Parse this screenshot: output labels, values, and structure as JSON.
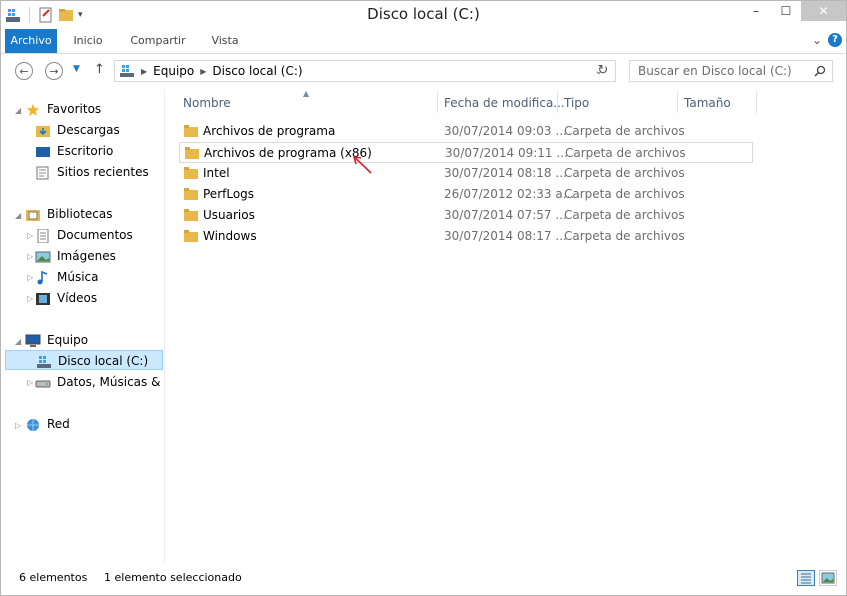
{
  "window": {
    "title": "Disco local (C:)",
    "minimize": "–",
    "maximize": "☐",
    "close": "✕"
  },
  "ribbon": {
    "tabs": [
      "Archivo",
      "Inicio",
      "Compartir",
      "Vista"
    ],
    "help": "?",
    "expand": "⌄"
  },
  "address": {
    "crumbs": [
      "Equipo",
      "Disco local (C:)"
    ],
    "search_placeholder": "Buscar en Disco local (C:)"
  },
  "navpane": {
    "favorites": "Favoritos",
    "fav_items": [
      "Descargas",
      "Escritorio",
      "Sitios recientes"
    ],
    "libraries": "Bibliotecas",
    "lib_items": [
      "Documentos",
      "Imágenes",
      "Música",
      "Vídeos"
    ],
    "computer": "Equipo",
    "comp_items": [
      "Disco local (C:)",
      "Datos, Músicas & Vi"
    ],
    "network": "Red"
  },
  "columns": {
    "name": "Nombre",
    "date": "Fecha de modifica...",
    "type": "Tipo",
    "size": "Tamaño"
  },
  "files": [
    {
      "name": "Archivos de programa",
      "date": "30/07/2014 09:03 ...",
      "type": "Carpeta de archivos"
    },
    {
      "name": "Archivos de programa (x86)",
      "date": "30/07/2014 09:11 ...",
      "type": "Carpeta de archivos"
    },
    {
      "name": "Intel",
      "date": "30/07/2014 08:18 ...",
      "type": "Carpeta de archivos"
    },
    {
      "name": "PerfLogs",
      "date": "26/07/2012 02:33 a...",
      "type": "Carpeta de archivos"
    },
    {
      "name": "Usuarios",
      "date": "30/07/2014 07:57 ...",
      "type": "Carpeta de archivos"
    },
    {
      "name": "Windows",
      "date": "30/07/2014 08:17 ...",
      "type": "Carpeta de archivos"
    }
  ],
  "status": {
    "count": "6 elementos",
    "selected": "1 elemento seleccionado"
  },
  "colors": {
    "accent": "#1979ca",
    "folder": "#e8b84a",
    "annotation": "#e0202a"
  }
}
